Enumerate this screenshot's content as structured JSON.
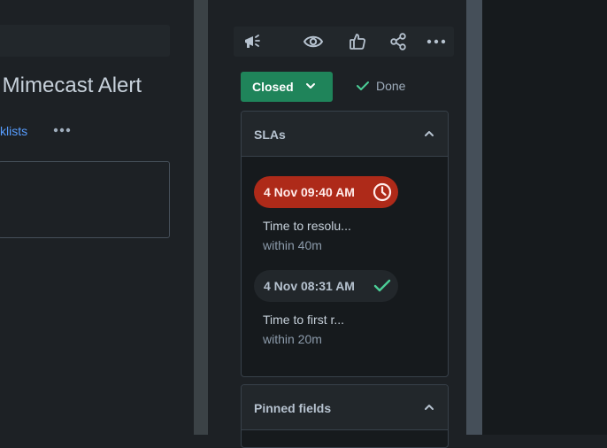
{
  "issue": {
    "title": "n. Mimecast Alert",
    "tab_partial": "klists"
  },
  "toolbar": {
    "icons": [
      "megaphone-icon",
      "eye-icon",
      "thumbs-up-icon",
      "share-icon",
      "more-icon"
    ]
  },
  "status": {
    "label": "Closed",
    "resolution": "Done"
  },
  "slas": {
    "title": "SLAs",
    "items": [
      {
        "time": "4 Nov 09:40 AM",
        "state": "breached",
        "name": "Time to resolu...",
        "goal": "within 40m"
      },
      {
        "time": "4 Nov 08:31 AM",
        "state": "met",
        "name": "Time to first r...",
        "goal": "within 20m"
      }
    ]
  },
  "pinned": {
    "title": "Pinned fields"
  },
  "colors": {
    "status_green": "#1f845a",
    "breached_red": "#ae2a19",
    "met_green": "#4bce97",
    "link_blue": "#579dff"
  }
}
